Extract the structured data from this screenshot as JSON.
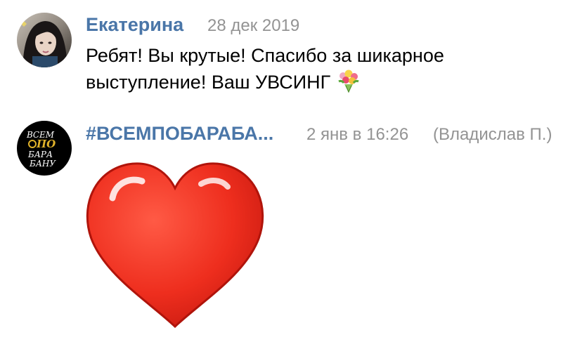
{
  "comments": [
    {
      "author": "Екатерина",
      "date": "28 дек 2019",
      "text": "Ребят! Вы крутые! Спасибо за шикарное выступление! Ваш УВСИНГ",
      "emoji": "bouquet-emoji"
    },
    {
      "author": "#ВСЕМПОБАРАБА...",
      "date": "2 янв в 16:26",
      "signer": "(Владислав П.)",
      "avatar_logo": {
        "line1": "ВСЕМ",
        "line2": "ПО",
        "line3": "БАРА",
        "line4": "БАНУ"
      },
      "sticker": "red-heart-sticker"
    }
  ],
  "colors": {
    "author_link": "#4a76a8",
    "meta_text": "#939393",
    "heart_red": "#e8261c"
  }
}
